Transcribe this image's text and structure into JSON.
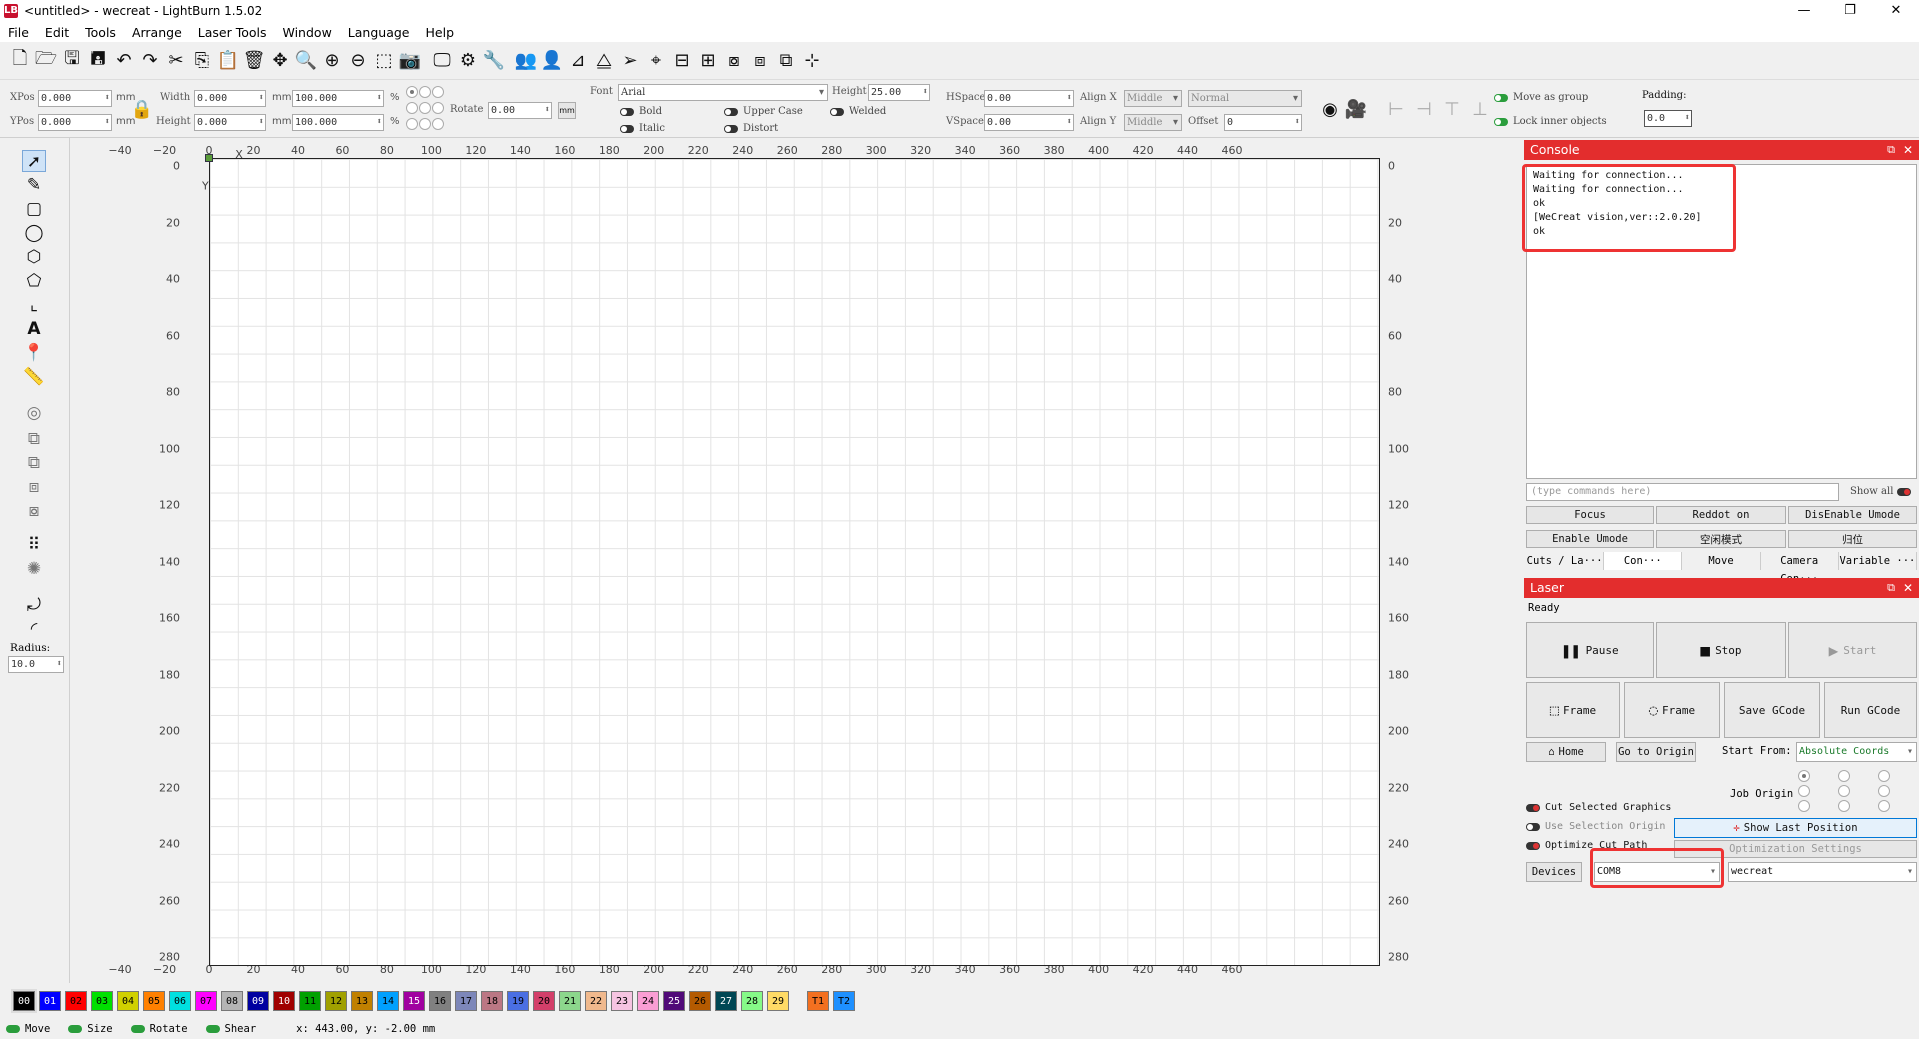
{
  "window": {
    "title": "<untitled> - wecreat - LightBurn 1.5.02",
    "logo": "LB",
    "controls": [
      "—",
      "❐",
      "✕"
    ]
  },
  "menubar": [
    "File",
    "Edit",
    "Tools",
    "Arrange",
    "Laser Tools",
    "Window",
    "Language",
    "Help"
  ],
  "toolbar_icons": [
    "new-file-icon",
    "open-folder-icon",
    "save-icon",
    "save-as-icon",
    "undo-icon",
    "redo-icon",
    "cut-icon",
    "copy-icon",
    "paste-icon",
    "delete-icon",
    "pan-icon",
    "zoom-icon",
    "zoom-in-icon",
    "zoom-out-icon",
    "select-frame-icon",
    "camera-icon",
    "monitor-icon",
    "settings-icon",
    "tools-icon",
    "group-icon",
    "user-icon",
    "mirror-icon",
    "flip-icon",
    "send-icon",
    "target-icon",
    "align-icon",
    "distribute-icon",
    "align-center-icon",
    "distribute-h-icon",
    "distribute-v-icon",
    "dock-icon"
  ],
  "props": {
    "xpos_label": "XPos",
    "xpos": "0.000",
    "ypos_label": "YPos",
    "ypos": "0.000",
    "unit": "mm",
    "width_label": "Width",
    "width": "0.000",
    "height_label": "Height",
    "height": "0.000",
    "scale_w": "100.000",
    "scale_h": "100.000",
    "percent": "%",
    "rotate_label": "Rotate",
    "rotate": "0.00",
    "rotate_unit": "mm",
    "font_label": "Font",
    "font": "Arial",
    "fheight_label": "Height",
    "fheight": "25.00",
    "bold": "Bold",
    "italic": "Italic",
    "upper": "Upper Case",
    "distort": "Distort",
    "welded": "Welded",
    "hspace_label": "HSpace",
    "hspace": "0.00",
    "vspace_label": "VSpace",
    "vspace": "0.00",
    "alignx_label": "Align X",
    "alignx": "Middle",
    "aligny_label": "Align Y",
    "aligny": "Middle",
    "normal": "Normal",
    "offset_label": "Offset",
    "offset": "0",
    "move_group": "Move as group",
    "lock_inner": "Lock inner objects",
    "padding_label": "Padding:",
    "padding": "0.0"
  },
  "left_tools": [
    "select-arrow-icon",
    "pen-icon",
    "rectangle-icon",
    "ellipse-icon",
    "polygon-icon",
    "pentagon-icon",
    "frame-icon",
    "text-icon",
    "position-pin-icon",
    "measure-icon",
    "boolean-icon",
    "weld-icon",
    "union-icon",
    "subtract-icon",
    "intersect-icon",
    "grid-array-icon",
    "circular-array-icon",
    "rotate-corner-icon",
    "round-corner-icon"
  ],
  "radius_label": "Radius:",
  "radius": "10.0",
  "ruler_x": [
    "−40",
    "−20",
    "0",
    "20",
    "40",
    "60",
    "80",
    "100",
    "120",
    "140",
    "160",
    "180",
    "200",
    "220",
    "240",
    "260",
    "280",
    "300",
    "320",
    "340",
    "360",
    "380",
    "400",
    "420",
    "440",
    "460"
  ],
  "ruler_y": [
    "0",
    "20",
    "40",
    "60",
    "80",
    "100",
    "120",
    "140",
    "160",
    "180",
    "200",
    "220",
    "240",
    "260",
    "280"
  ],
  "axis_x": "X",
  "axis_y": "Y",
  "console": {
    "title": "Console",
    "lines": [
      "Waiting for connection...",
      "Waiting for connection...",
      "ok",
      "[WeCreat vision,ver::2.0.20]",
      "ok"
    ],
    "placeholder": "(type commands here)",
    "show_all": "Show all",
    "buttons": [
      "Focus",
      "Reddot on",
      "DisEnable Umode",
      "Enable Umode",
      "空闲模式",
      "归位"
    ],
    "tabs": [
      "Cuts / La···",
      "Con···",
      "Move",
      "Camera Con···",
      "Variable ···"
    ]
  },
  "laser": {
    "title": "Laser",
    "status": "Ready",
    "pause": "Pause",
    "stop": "Stop",
    "start": "Start",
    "frame1": "Frame",
    "frame2": "Frame",
    "save_gcode": "Save GCode",
    "run_gcode": "Run GCode",
    "home": "Home",
    "go_origin": "Go to Origin",
    "start_from_label": "Start From:",
    "start_from": "Absolute Coords",
    "job_origin": "Job Origin",
    "cut_selected": "Cut Selected Graphics",
    "use_selection": "Use Selection Origin",
    "optimize": "Optimize Cut Path",
    "show_last": "Show Last Position",
    "opt_settings": "Optimization Settings",
    "devices": "Devices",
    "port": "COM8",
    "device": "wecreat"
  },
  "palette": [
    {
      "label": "00",
      "color": "#000000",
      "text": "#ffffff"
    },
    {
      "label": "01",
      "color": "#0000ff",
      "text": "#ffffff"
    },
    {
      "label": "02",
      "color": "#ff0000",
      "text": "#000000"
    },
    {
      "label": "03",
      "color": "#00e000",
      "text": "#000000"
    },
    {
      "label": "04",
      "color": "#d0d000",
      "text": "#000000"
    },
    {
      "label": "05",
      "color": "#ff8000",
      "text": "#000000"
    },
    {
      "label": "06",
      "color": "#00e0e0",
      "text": "#000000"
    },
    {
      "label": "07",
      "color": "#ff00ff",
      "text": "#000000"
    },
    {
      "label": "08",
      "color": "#b4b4b4",
      "text": "#000000"
    },
    {
      "label": "09",
      "color": "#0000a0",
      "text": "#ffffff"
    },
    {
      "label": "10",
      "color": "#a00000",
      "text": "#ffffff"
    },
    {
      "label": "11",
      "color": "#00a000",
      "text": "#000000"
    },
    {
      "label": "12",
      "color": "#a0a000",
      "text": "#000000"
    },
    {
      "label": "13",
      "color": "#c08000",
      "text": "#000000"
    },
    {
      "label": "14",
      "color": "#00a0ff",
      "text": "#000000"
    },
    {
      "label": "15",
      "color": "#a000a0",
      "text": "#ffffff"
    },
    {
      "label": "16",
      "color": "#808080",
      "text": "#000000"
    },
    {
      "label": "17",
      "color": "#7d87b9",
      "text": "#000000"
    },
    {
      "label": "18",
      "color": "#bb7784",
      "text": "#000000"
    },
    {
      "label": "19",
      "color": "#4a6fe3",
      "text": "#000000"
    },
    {
      "label": "20",
      "color": "#d33f6a",
      "text": "#000000"
    },
    {
      "label": "21",
      "color": "#8cd78c",
      "text": "#000000"
    },
    {
      "label": "22",
      "color": "#f0b98d",
      "text": "#000000"
    },
    {
      "label": "23",
      "color": "#f6c4e1",
      "text": "#000000"
    },
    {
      "label": "24",
      "color": "#fa9ed4",
      "text": "#000000"
    },
    {
      "label": "25",
      "color": "#500a78",
      "text": "#ffffff"
    },
    {
      "label": "26",
      "color": "#b45a00",
      "text": "#000000"
    },
    {
      "label": "27",
      "color": "#004754",
      "text": "#ffffff"
    },
    {
      "label": "28",
      "color": "#86fa88",
      "text": "#000000"
    },
    {
      "label": "29",
      "color": "#ffdb66",
      "text": "#000000"
    },
    {
      "label": "T1",
      "color": "#f37020",
      "text": "#000000"
    },
    {
      "label": "T2",
      "color": "#1e90ff",
      "text": "#000000"
    }
  ],
  "status": {
    "move": "Move",
    "size": "Size",
    "rotate": "Rotate",
    "shear": "Shear",
    "coords": "x: 443.00, y: -2.00 mm"
  }
}
